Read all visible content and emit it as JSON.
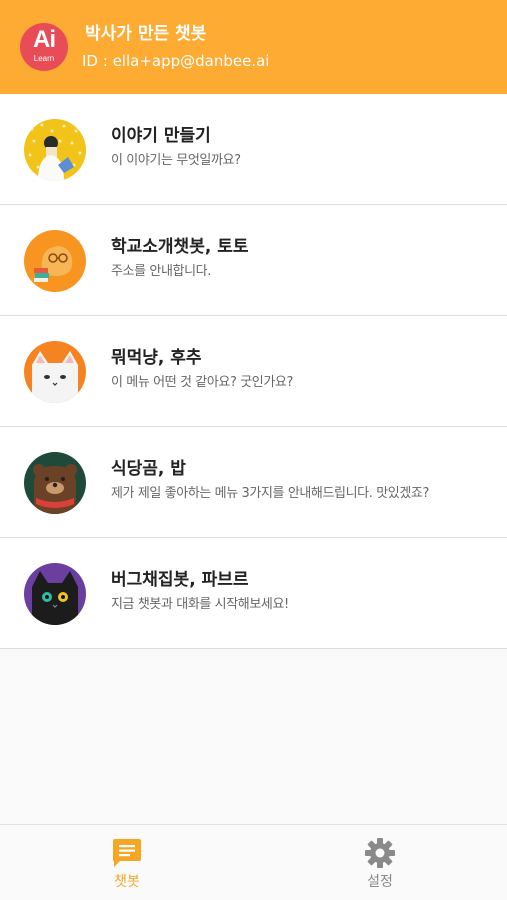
{
  "header": {
    "logo_top": "Ai",
    "logo_bottom": "Learn",
    "title": "박사가 만든 챗봇",
    "user_id": "ID : ella+app@danbee.ai"
  },
  "chatbots": [
    {
      "title": "이야기 만들기",
      "subtitle": "이 이야기는 무엇일까요?",
      "avatar_color": "#f2c318"
    },
    {
      "title": "학교소개챗봇, 토토",
      "subtitle": "주소를 안내합니다.",
      "avatar_color": "#f79520"
    },
    {
      "title": "뭐먹냥, 후추",
      "subtitle": "이 메뉴 어떤 것 같아요? 굿인가요?",
      "avatar_color": "#f5831f"
    },
    {
      "title": "식당곰, 밥",
      "subtitle": "제가 제일 좋아하는 메뉴 3가지를 안내해드립니다. 맛있겠죠?",
      "avatar_color": "#1f4a3a"
    },
    {
      "title": "버그채집봇, 파브르",
      "subtitle": "지금 챗봇과 대화를 시작해보세요!",
      "avatar_color": "#6b3fa0"
    }
  ],
  "tabs": [
    {
      "label": "챗봇",
      "icon": "chat-icon",
      "active": true
    },
    {
      "label": "설정",
      "icon": "gear-icon",
      "active": false
    }
  ],
  "colors": {
    "accent": "#fdab33",
    "logo": "#e84d57",
    "active_tab": "#f5a623",
    "inactive_tab": "#8a8a8a"
  }
}
